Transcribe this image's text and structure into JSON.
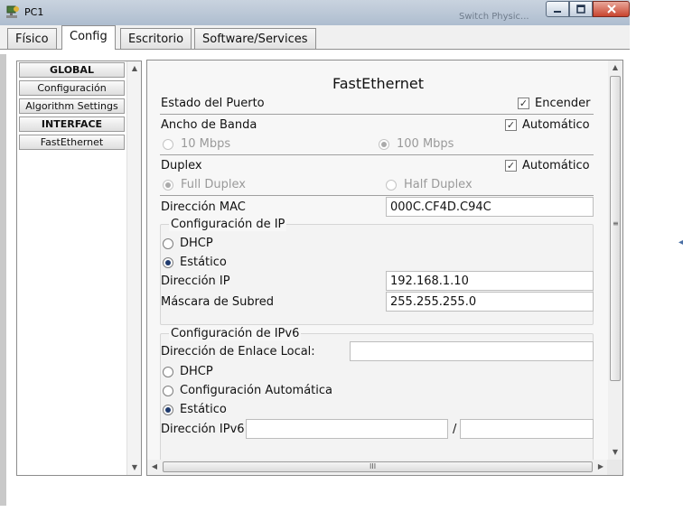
{
  "window": {
    "title": "PC1",
    "background_title": "Switch Physic..."
  },
  "tabs": [
    "Físico",
    "Config",
    "Escritorio",
    "Software/Services"
  ],
  "active_tab": "Config",
  "nav": {
    "items": [
      {
        "label": "GLOBAL",
        "type": "header"
      },
      {
        "label": "Configuración",
        "type": "item"
      },
      {
        "label": "Algorithm Settings",
        "type": "item"
      },
      {
        "label": "INTERFACE",
        "type": "header"
      },
      {
        "label": "FastEthernet",
        "type": "item"
      }
    ]
  },
  "panel": {
    "title": "FastEthernet",
    "port_status_label": "Estado del Puerto",
    "port_on_label": "Encender",
    "port_on_checked": true,
    "bandwidth_label": "Ancho de Banda",
    "bandwidth_auto_label": "Automático",
    "bandwidth_auto_checked": true,
    "bw_10_label": "10 Mbps",
    "bw_100_label": "100 Mbps",
    "bw_selected": "100 Mbps",
    "duplex_label": "Duplex",
    "duplex_auto_label": "Automático",
    "duplex_auto_checked": true,
    "full_duplex_label": "Full Duplex",
    "half_duplex_label": "Half Duplex",
    "duplex_selected": "Full Duplex",
    "mac_label": "Dirección MAC",
    "mac_value": "000C.CF4D.C94C",
    "ip_group_title": "Configuración de IP",
    "ip_dhcp_label": "DHCP",
    "ip_static_label": "Estático",
    "ip_mode": "Estático",
    "ip_address_label": "Dirección IP",
    "ip_address_value": "192.168.1.10",
    "subnet_label": "Máscara de Subred",
    "subnet_value": "255.255.255.0",
    "ipv6_group_title": "Configuración de IPv6",
    "link_local_label": "Dirección de Enlace Local:",
    "link_local_value": "",
    "ipv6_dhcp_label": "DHCP",
    "ipv6_auto_label": "Configuración Automática",
    "ipv6_static_label": "Estático",
    "ipv6_mode": "Estático",
    "ipv6_address_label": "Dirección IPv6",
    "ipv6_address_value": "",
    "ipv6_prefix_separator": "/",
    "ipv6_prefix_value": ""
  },
  "glyphs": {
    "check": "✓",
    "up": "▲",
    "down": "▼",
    "left": "◀",
    "right": "▶",
    "hgrip": "III",
    "vgrip": "≡",
    "edge": "◀"
  },
  "colors": {
    "radio_selected": "#1e3a6e",
    "close_button": "#c8442e",
    "titlebar": "#aebdcf"
  }
}
